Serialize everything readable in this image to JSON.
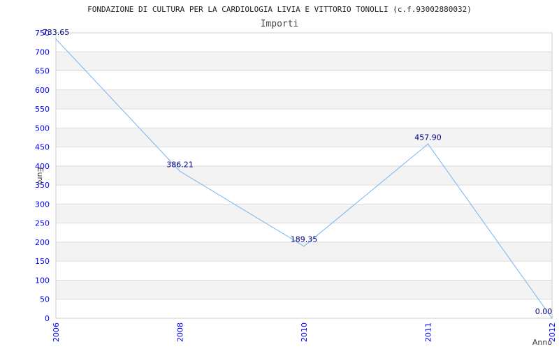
{
  "chart_data": {
    "type": "line",
    "title": "FONDAZIONE DI CULTURA PER LA CARDIOLOGIA LIVIA E VITTORIO TONOLLI (c.f.93002880032)",
    "subtitle": "Importi",
    "xlabel": "Anno",
    "ylabel": "Euro",
    "categories": [
      "2006",
      "2008",
      "2010",
      "2011",
      "2012"
    ],
    "values": [
      733.65,
      386.21,
      189.35,
      457.9,
      0.0
    ],
    "data_labels": [
      "733.65",
      "386.21",
      "189.35",
      "457.90",
      "0.00"
    ],
    "ylim": [
      0,
      750
    ],
    "yticks": [
      0,
      50,
      100,
      150,
      200,
      250,
      300,
      350,
      400,
      450,
      500,
      550,
      600,
      650,
      700,
      750
    ],
    "grid": true,
    "colors": {
      "line": "#77b3ee",
      "tick_labels": "#0000ff",
      "data_labels": "#000080",
      "band": "#f3f3f3",
      "grid": "#dddddd"
    }
  }
}
